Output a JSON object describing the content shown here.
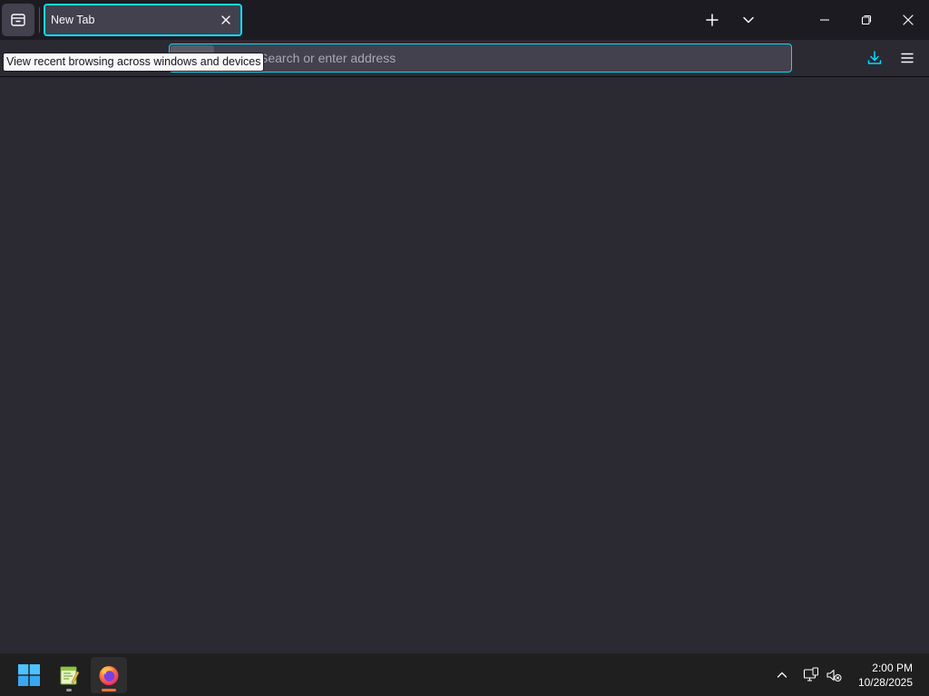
{
  "browser": {
    "tabs": [
      {
        "title": "New Tab",
        "active": true
      }
    ],
    "firefox_view_tooltip": "View recent browsing across windows and devices",
    "urlbar": {
      "placeholder": "Search or enter address",
      "value": ""
    },
    "accent_color": "#00ddff",
    "icons": {
      "firefox_view": "firefox-view-icon",
      "tab_close": "close-icon",
      "new_tab": "plus-icon",
      "list_all_tabs": "chevron-down-icon",
      "minimize": "minimize-icon",
      "restore": "restore-icon",
      "close_window": "close-icon",
      "downloads": "download-icon",
      "menu": "hamburger-menu-icon"
    }
  },
  "taskbar": {
    "apps": [
      {
        "name": "start",
        "icon": "windows-start-icon"
      },
      {
        "name": "notepad++",
        "icon": "notepad-plus-plus-icon",
        "running": true
      },
      {
        "name": "firefox",
        "icon": "firefox-icon",
        "running": true,
        "active": true
      }
    ],
    "tray_icons": [
      "chevron-up-icon",
      "network-icon",
      "volume-muted-icon"
    ],
    "clock": {
      "time": "2:00 PM",
      "date": "10/28/2025"
    }
  }
}
